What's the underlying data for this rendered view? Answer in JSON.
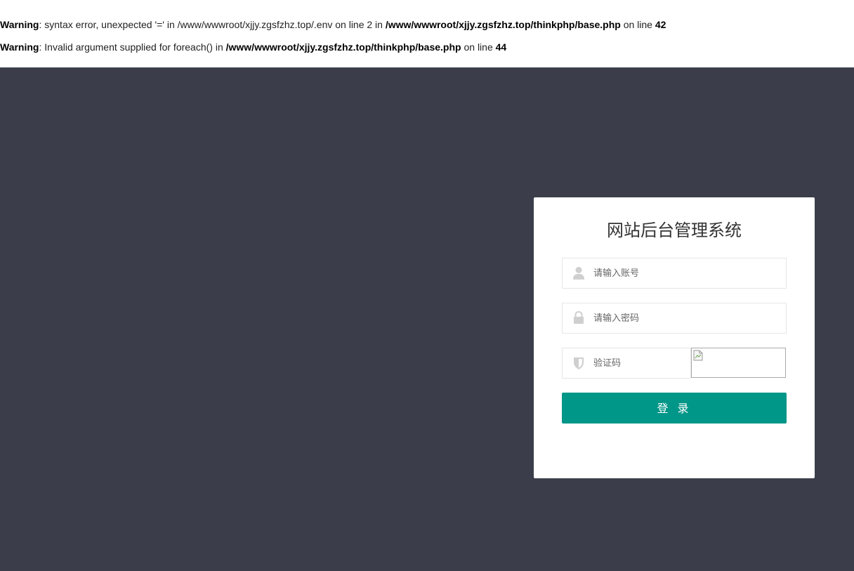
{
  "warnings": [
    {
      "label": "Warning",
      "text": ": syntax error, unexpected '=' in /www/wwwroot/xjjy.zgsfzhz.top/.env on line 2 in ",
      "file": "/www/wwwroot/xjjy.zgsfzhz.top/thinkphp/base.php",
      "on_line": " on line ",
      "line": "42"
    },
    {
      "label": "Warning",
      "text": ": Invalid argument supplied for foreach() in ",
      "file": "/www/wwwroot/xjjy.zgsfzhz.top/thinkphp/base.php",
      "on_line": " on line ",
      "line": "44"
    }
  ],
  "login": {
    "title": "网站后台管理系统",
    "username_placeholder": "请输入账号",
    "password_placeholder": "请输入密码",
    "captcha_placeholder": "验证码",
    "submit_label": "登 录"
  },
  "icons": {
    "username": "user-icon",
    "password": "lock-icon",
    "captcha": "shield-icon",
    "captcha_image": "broken-image-icon"
  },
  "colors": {
    "background": "#3b3e4a",
    "button": "#009688",
    "card": "#ffffff"
  }
}
